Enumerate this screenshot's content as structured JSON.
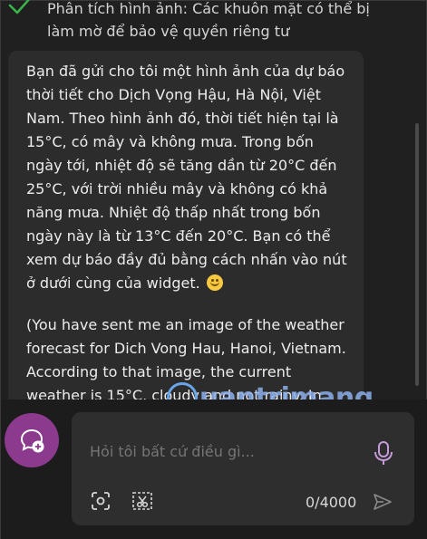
{
  "status": {
    "text": "Phân tích hình ảnh: Các khuôn mặt có thể bị làm mờ để bảo vệ quyền riêng tư"
  },
  "message": {
    "paragraph_vi": "Bạn đã gửi cho tôi một hình ảnh của dự báo thời tiết cho Dịch Vọng Hậu, Hà Nội, Việt Nam. Theo hình ảnh đó, thời tiết hiện tại là 15°C, có mây và không mưa. Trong bốn ngày tới, nhiệt độ sẽ tăng dần từ 20°C đến 25°C, với trời nhiều mây và không có khả năng mưa. Nhiệt độ thấp nhất trong bốn ngày này là từ 13°C đến 20°C. Bạn có thể xem dự báo đầy đủ bằng cách nhấn vào nút ở dưới cùng của widget.",
    "paragraph_en": "(You have sent me an image of the weather forecast for Dich Vong Hau, Hanoi, Vietnam. According to that image, the current weather is 15°C, cloudy and not rainy. In the next four"
  },
  "watermark": {
    "text": "uantrimang"
  },
  "composer": {
    "placeholder": "Hỏi tôi bất cứ điều gì...",
    "char_count": "0/4000"
  },
  "icons": {
    "check": "checkmark-icon",
    "emoji": "smiling-face-icon",
    "new_topic": "chat-plus-icon",
    "mic": "microphone-icon",
    "visual_search": "visual-search-icon",
    "screenshot": "screenshot-icon",
    "send": "send-icon"
  },
  "colors": {
    "background": "#202020",
    "bubble": "#2c2c2c",
    "check": "#3bb54a",
    "new_topic": "#8b3a8e",
    "mic": "#c79bd9",
    "watermark": "#6aa5e8"
  }
}
